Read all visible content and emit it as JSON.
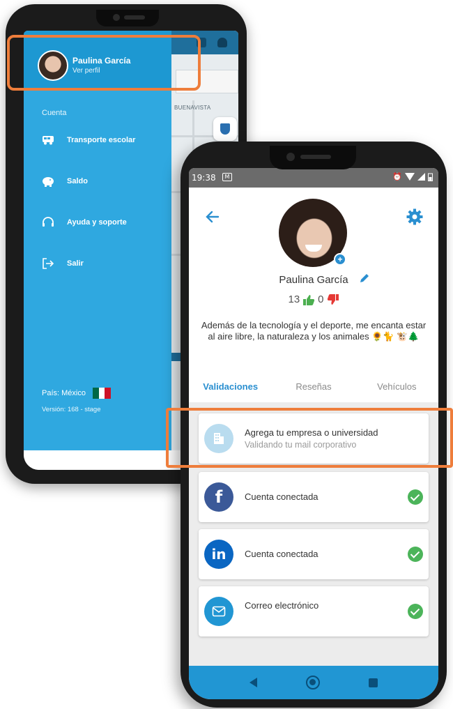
{
  "drawer": {
    "user_name": "Paulina García",
    "profile_link": "Ver perfil",
    "section_label": "Cuenta",
    "items": [
      {
        "label": "Transporte escolar",
        "icon": "bus-icon"
      },
      {
        "label": "Saldo",
        "icon": "piggy-bank-icon"
      },
      {
        "label": "Ayuda y soporte",
        "icon": "support-headset-icon"
      },
      {
        "label": "Salir",
        "icon": "logout-icon"
      }
    ],
    "country": "País: México",
    "version": "Versión: 168 - stage"
  },
  "map": {
    "street_label": "BUENAVISTA"
  },
  "status_bar": {
    "time": "19:38",
    "message_glyph": "M",
    "alarm_glyph": "⏰"
  },
  "profile": {
    "name": "Paulina García",
    "likes": "13",
    "dislikes": "0",
    "bio": "Además de la tecnología y el deporte, me encanta estar al aire libre, la naturaleza y los animales 🌻🐈 🐮🌲",
    "plus": "+"
  },
  "tabs": [
    {
      "label": "Validaciones",
      "active": true
    },
    {
      "label": "Reseñas",
      "active": false
    },
    {
      "label": "Vehículos",
      "active": false
    }
  ],
  "validations": {
    "company": {
      "title": "Agrega tu empresa o universidad",
      "subtitle": "Validando tu mail corporativo",
      "icon": "building-icon"
    },
    "facebook": {
      "label": "Cuenta conectada",
      "icon_text": "f"
    },
    "linkedin": {
      "label": "Cuenta conectada",
      "icon_text": "in"
    },
    "email": {
      "label": "Correo electrónico"
    }
  },
  "colors": {
    "accent": "#2a8fd0",
    "drawer_blue": "#2fa8e0",
    "highlight_orange": "#ee7d3b",
    "check_green": "#4cb45a",
    "facebook_blue": "#3b5998",
    "linkedin_blue": "#0a66c2",
    "like_green": "#4caf50",
    "dislike_red": "#e53935"
  }
}
